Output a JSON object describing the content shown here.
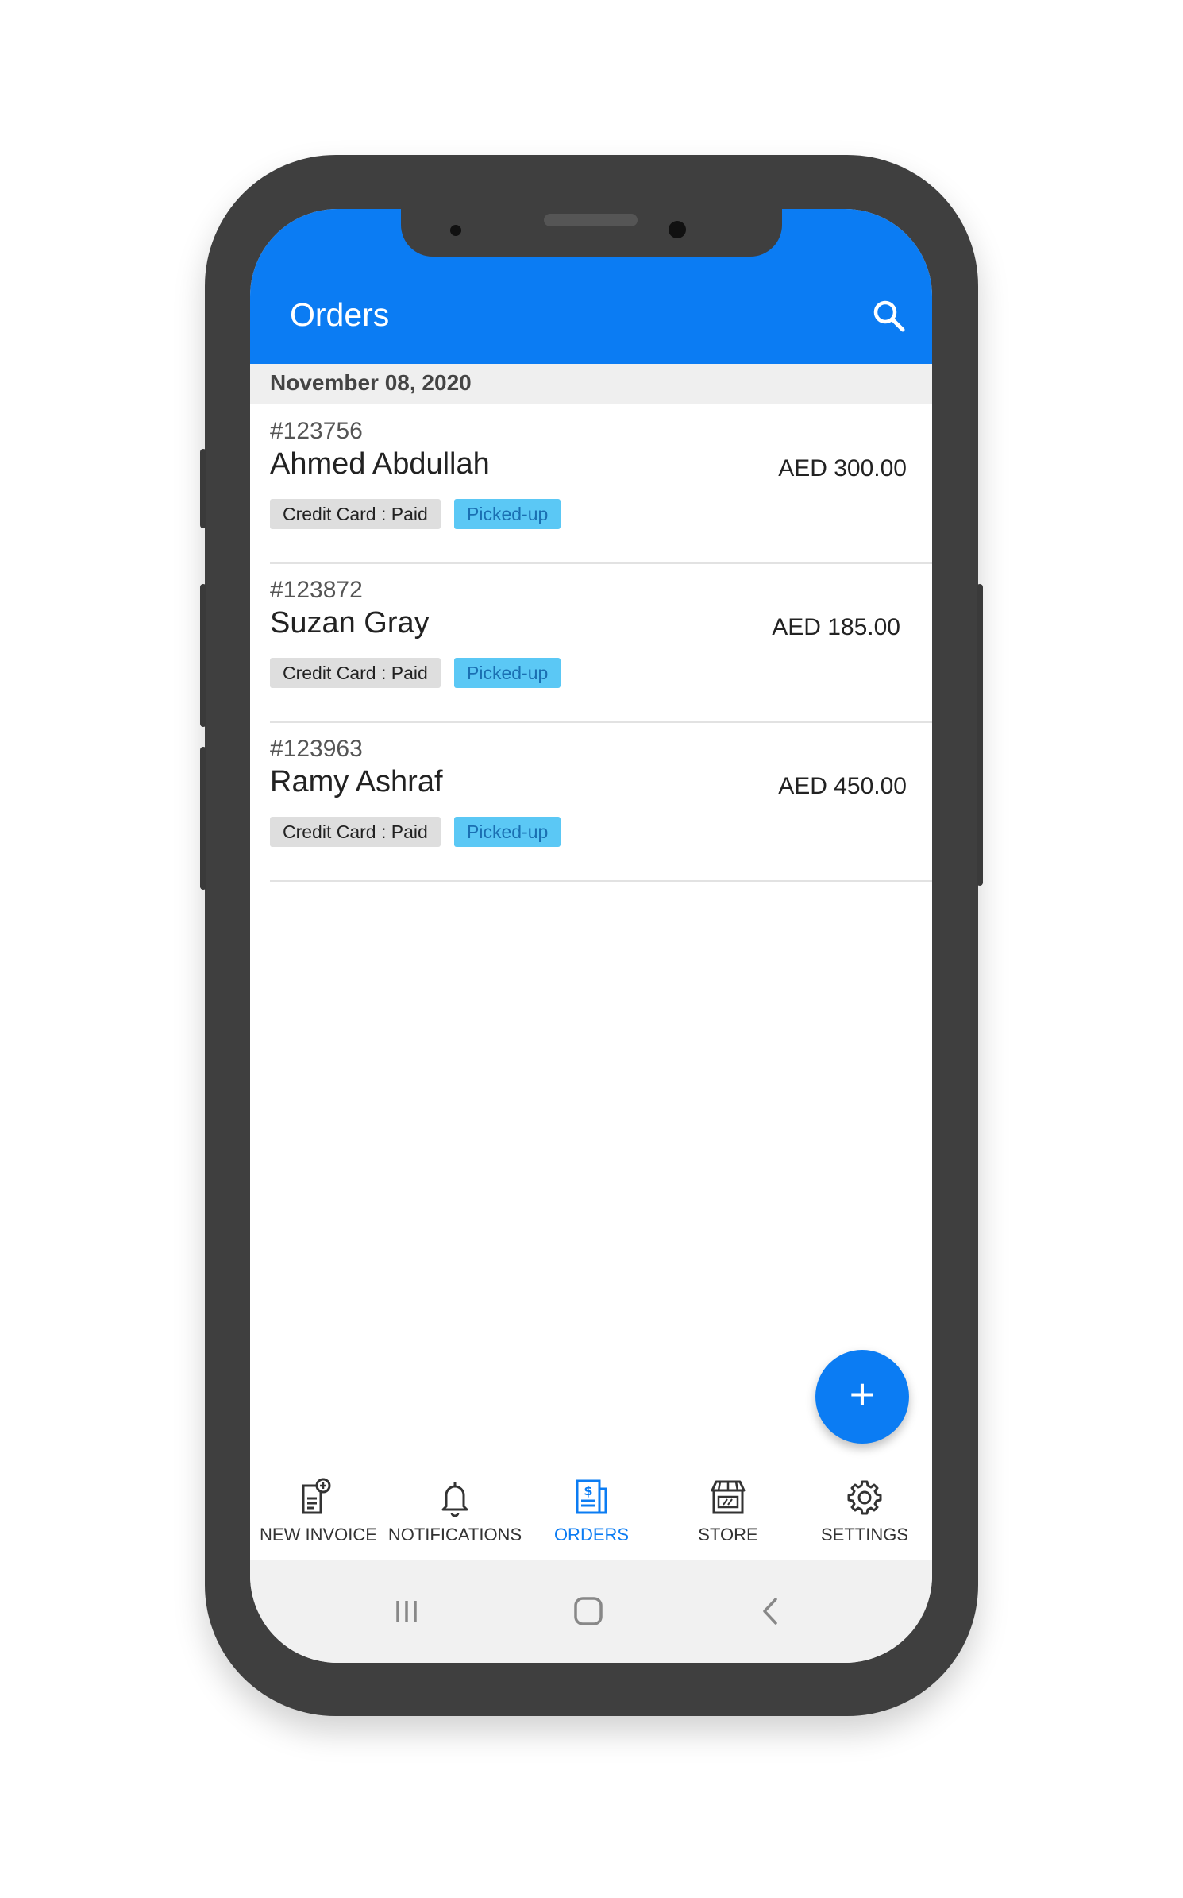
{
  "app": {
    "title": "Orders",
    "accent_color": "#0b7cf3",
    "search_icon": "search-icon"
  },
  "section": {
    "date": "November 08, 2020"
  },
  "orders": [
    {
      "id": "#123756",
      "customer": "Ahmed Abdullah",
      "amount": "AED 300.00",
      "payment": "Credit Card : Paid",
      "status": "Picked-up"
    },
    {
      "id": "#123872",
      "customer": "Suzan Gray",
      "amount": "AED 185.00",
      "payment": "Credit Card : Paid",
      "status": "Picked-up"
    },
    {
      "id": "#123963",
      "customer": "Ramy Ashraf",
      "amount": "AED 450.00",
      "payment": "Credit Card : Paid",
      "status": "Picked-up"
    }
  ],
  "fab": {
    "icon": "plus-icon",
    "symbol": "+"
  },
  "bottom_nav": {
    "items": [
      {
        "label": "NEW INVOICE",
        "icon": "new-invoice-icon",
        "active": false
      },
      {
        "label": "NOTIFICATIONS",
        "icon": "bell-icon",
        "active": false
      },
      {
        "label": "ORDERS",
        "icon": "orders-icon",
        "active": true
      },
      {
        "label": "STORE",
        "icon": "store-icon",
        "active": false
      },
      {
        "label": "SETTINGS",
        "icon": "gear-icon",
        "active": false
      }
    ]
  },
  "system_nav": {
    "buttons": [
      "recent-apps-icon",
      "home-icon",
      "back-icon"
    ]
  }
}
